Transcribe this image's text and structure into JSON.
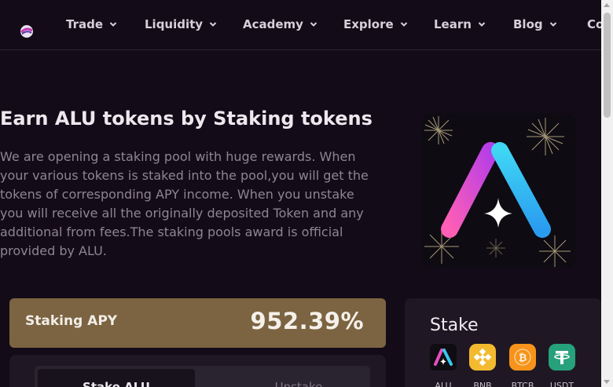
{
  "nav": {
    "items": [
      {
        "label": "Trade"
      },
      {
        "label": "Liquidity"
      },
      {
        "label": "Academy"
      },
      {
        "label": "Explore"
      },
      {
        "label": "Learn"
      },
      {
        "label": "Blog"
      },
      {
        "label": "Co"
      }
    ]
  },
  "hero": {
    "title": "Earn ALU tokens by Staking tokens",
    "description": "We are opening a staking pool with huge rewards. When your various tokens is staked into the pool,you will get the tokens of corresponding APY income. When you unstake you will receive all the originally deposited Token and any additional from fees.The staking pools award is official provided by ALU."
  },
  "apy": {
    "label": "Staking APY",
    "value": "952.39%"
  },
  "tabs": {
    "stake": "Stake ALU",
    "unstake": "Unstake"
  },
  "stake_card": {
    "title": "Stake",
    "tokens": [
      {
        "label": "ALU",
        "icon": "alu-icon",
        "color": "#0f0c12"
      },
      {
        "label": "BNB",
        "icon": "bnb-icon",
        "color": "#f3ba2f"
      },
      {
        "label": "BTCB",
        "icon": "btcb-icon",
        "color": "#f7931a"
      },
      {
        "label": "USDT",
        "icon": "usdt-icon",
        "color": "#26a17b"
      }
    ]
  },
  "colors": {
    "background": "#130b17",
    "apy_bar": "#7c6442",
    "panel": "#1f1824"
  }
}
